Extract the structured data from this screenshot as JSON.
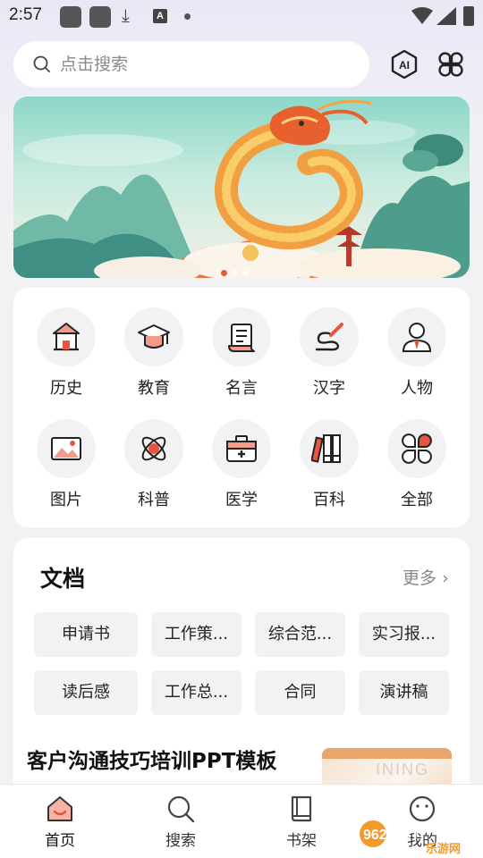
{
  "status_bar": {
    "time": "2:57",
    "icons": [
      "notification-icon",
      "notification-icon",
      "download-icon",
      "font-icon",
      "dot-icon",
      "wifi-icon",
      "signal-icon",
      "battery-icon"
    ],
    "a_glyph": "A"
  },
  "search": {
    "placeholder": "点击搜索",
    "ai_label": "AI"
  },
  "banner": {
    "slides": 3,
    "active_slide": 1
  },
  "categories": [
    {
      "label": "历史",
      "icon": "building-icon"
    },
    {
      "label": "教育",
      "icon": "graduation-cap-icon"
    },
    {
      "label": "名言",
      "icon": "scroll-icon"
    },
    {
      "label": "汉字",
      "icon": "brush-icon"
    },
    {
      "label": "人物",
      "icon": "person-icon"
    },
    {
      "label": "图片",
      "icon": "image-icon"
    },
    {
      "label": "科普",
      "icon": "atom-icon"
    },
    {
      "label": "医学",
      "icon": "medical-kit-icon"
    },
    {
      "label": "百科",
      "icon": "books-icon"
    },
    {
      "label": "全部",
      "icon": "apps-icon"
    }
  ],
  "documents": {
    "title": "文档",
    "more": "更多",
    "tags": [
      "申请书",
      "工作策...",
      "综合范...",
      "实习报...",
      "读后感",
      "工作总...",
      "合同",
      "演讲稿"
    ],
    "featured": {
      "title": "客户沟通技巧培训PPT模板",
      "thumb_text": "INING"
    }
  },
  "bottom_nav": [
    {
      "label": "首页",
      "icon": "home-icon",
      "active": true
    },
    {
      "label": "搜索",
      "icon": "search-icon",
      "active": false
    },
    {
      "label": "书架",
      "icon": "bookshelf-icon",
      "active": false
    },
    {
      "label": "我的",
      "icon": "profile-icon",
      "active": false
    }
  ],
  "watermark": {
    "text": "962.NET",
    "subtext": "乐游网"
  },
  "colors": {
    "accent": "#e4523a",
    "background": "#f2f2f4",
    "card": "#ffffff",
    "banner_sky": "#8cd7c8"
  }
}
